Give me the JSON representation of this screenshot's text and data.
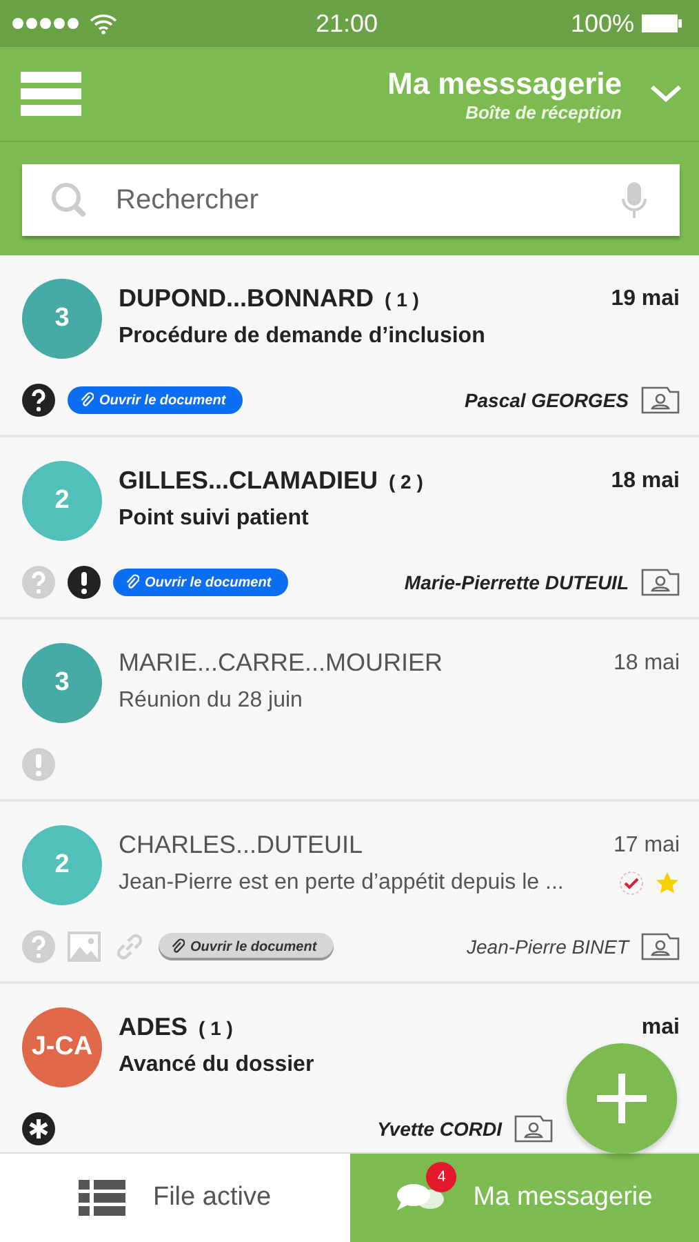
{
  "status_bar": {
    "time": "21:00",
    "battery": "100%"
  },
  "header": {
    "title": "Ma messsagerie",
    "subtitle": "Boîte de réception"
  },
  "search": {
    "placeholder": "Rechercher"
  },
  "messages": [
    {
      "avatar": "3",
      "color": "#46aaa5",
      "name": "DUPOND...BONNARD",
      "count": "( 1 )",
      "date": "19 mai",
      "subject": "Procédure de demande d’inclusion",
      "unread": true,
      "checked": false,
      "starred": false,
      "icons": [
        {
          "kind": "question",
          "active": true
        }
      ],
      "attachment": {
        "label": "Ouvrir le document",
        "active": true
      },
      "sender": "Pascal GEORGES"
    },
    {
      "avatar": "2",
      "color": "#52bfbb",
      "name": "GILLES...CLAMADIEU",
      "count": "( 2 )",
      "date": "18 mai",
      "subject": "Point suivi patient",
      "unread": true,
      "checked": false,
      "starred": false,
      "icons": [
        {
          "kind": "question",
          "active": false
        },
        {
          "kind": "exclamation",
          "active": true
        }
      ],
      "attachment": {
        "label": "Ouvrir le document",
        "active": true
      },
      "sender": "Marie-Pierrette DUTEUIL"
    },
    {
      "avatar": "3",
      "color": "#46aaa5",
      "name": "MARIE...CARRE...MOURIER",
      "date": "18 mai",
      "subject": "Réunion du 28 juin",
      "unread": false,
      "checked": false,
      "starred": false,
      "icons": [
        {
          "kind": "exclamation",
          "active": false
        }
      ]
    },
    {
      "avatar": "2",
      "color": "#52bfbb",
      "name": "CHARLES...DUTEUIL",
      "date": "17 mai",
      "subject": "Jean-Pierre est en perte d’appétit depuis le ...",
      "unread": false,
      "checked": true,
      "starred": true,
      "icons": [
        {
          "kind": "question",
          "active": false
        },
        {
          "kind": "image",
          "active": false
        },
        {
          "kind": "link",
          "active": false
        }
      ],
      "attachment": {
        "label": "Ouvrir le document",
        "active": false
      },
      "sender": "Jean-Pierre BINET"
    },
    {
      "avatar": "J-CA",
      "color": "#e0694a",
      "name": "ADES",
      "count": "( 1 )",
      "date": "mai",
      "subject": "Avancé du dossier",
      "unread": true,
      "checked": false,
      "starred": false,
      "icons": [
        {
          "kind": "asterisk",
          "active": true
        }
      ],
      "sender": "Yvette CORDI"
    }
  ],
  "tabs": [
    {
      "label": "File active",
      "selected": false
    },
    {
      "label": "Ma messagerie",
      "selected": true,
      "badge": "4"
    }
  ]
}
